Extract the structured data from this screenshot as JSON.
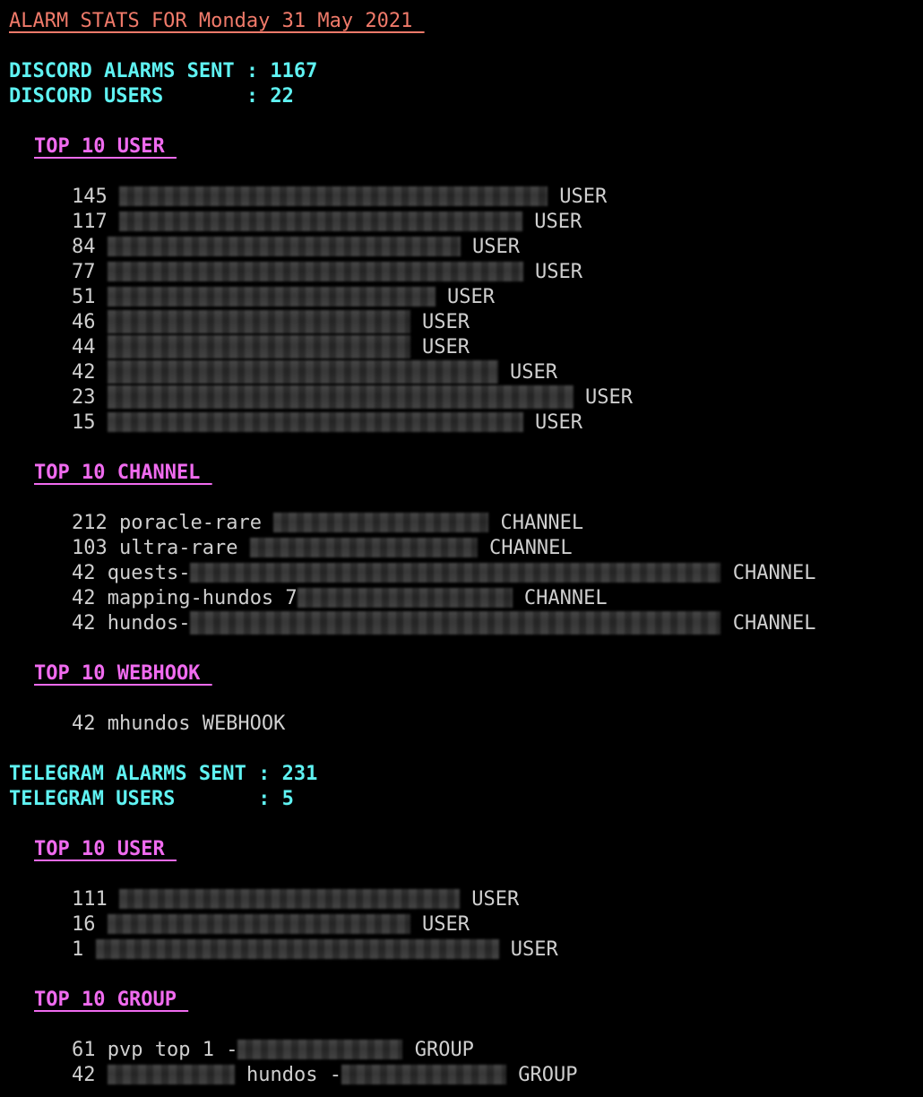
{
  "title": "ALARM STATS FOR Monday 31 May 2021 ",
  "colors": {
    "background": "#000000",
    "title": "#f07a6a",
    "stat": "#5ff2f2",
    "section": "#f06bef",
    "entry": "#cfcfcf"
  },
  "discord": {
    "alarms_sent": "DISCORD ALARMS SENT : 1167",
    "users": "DISCORD USERS       : 22",
    "top_user_heading": "TOP 10 USER ",
    "top_users": [
      {
        "count": "145",
        "kind": "USER"
      },
      {
        "count": "117",
        "kind": "USER"
      },
      {
        "count": "84",
        "kind": "USER"
      },
      {
        "count": "77",
        "kind": "USER"
      },
      {
        "count": "51",
        "kind": "USER"
      },
      {
        "count": "46",
        "kind": "USER"
      },
      {
        "count": "44",
        "kind": "USER"
      },
      {
        "count": "42",
        "kind": "USER"
      },
      {
        "count": "23",
        "kind": "USER"
      },
      {
        "count": "15",
        "kind": "USER"
      }
    ],
    "top_channel_heading": "TOP 10 CHANNEL ",
    "top_channels": [
      {
        "count": "212",
        "name": "poracle-rare",
        "kind": "CHANNEL"
      },
      {
        "count": "103",
        "name": "ultra-rare",
        "kind": "CHANNEL"
      },
      {
        "count": "42",
        "name": "quests-",
        "kind": "CHANNEL"
      },
      {
        "count": "42",
        "name": "mapping-hundos 7",
        "kind": "CHANNEL"
      },
      {
        "count": "42",
        "name": "hundos-",
        "kind": "CHANNEL"
      }
    ],
    "top_webhook_heading": "TOP 10 WEBHOOK ",
    "top_webhooks": [
      {
        "text": "42 mhundos WEBHOOK"
      }
    ]
  },
  "telegram": {
    "alarms_sent": "TELEGRAM ALARMS SENT : 231",
    "users": "TELEGRAM USERS       : 5",
    "top_user_heading": "TOP 10 USER ",
    "top_users": [
      {
        "count": "111",
        "kind": "USER"
      },
      {
        "count": "16",
        "kind": "USER"
      },
      {
        "count": "1",
        "kind": "USER"
      }
    ],
    "top_group_heading": "TOP 10 GROUP ",
    "top_groups": [
      {
        "count": "61",
        "name": "pvp top 1 -",
        "kind": "GROUP"
      },
      {
        "count": "42",
        "name": "hundos -",
        "kind": "GROUP"
      }
    ]
  }
}
